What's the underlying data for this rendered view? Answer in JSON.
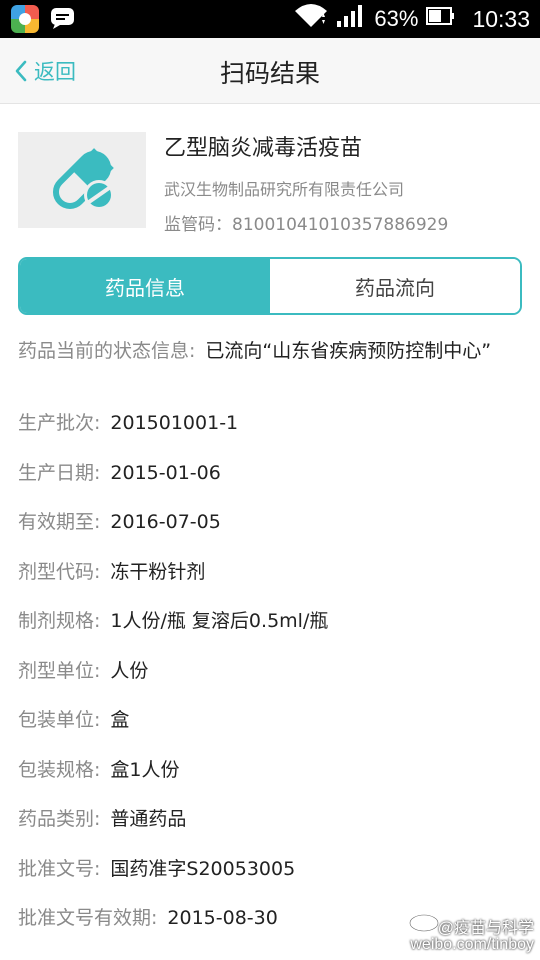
{
  "status_bar": {
    "battery_percent": "63%",
    "time": "10:33",
    "icons": [
      "app-launcher-icon",
      "message-icon",
      "wifi-icon",
      "signal-icon",
      "battery-icon"
    ]
  },
  "header": {
    "back_label": "返回",
    "title": "扫码结果"
  },
  "product": {
    "icon": "pill-icon",
    "name": "乙型脑炎减毒活疫苗",
    "company": "武汉生物制品研究所有限责任公司",
    "code_label": "监管码：81001041010357886929"
  },
  "tabs": [
    {
      "label": "药品信息",
      "active": true
    },
    {
      "label": "药品流向",
      "active": false
    }
  ],
  "details": [
    {
      "key": "药品当前的状态信息:",
      "value": "已流向“山东省疾病预防控制中心”"
    },
    {
      "key": "生产批次:",
      "value": "201501001-1"
    },
    {
      "key": "生产日期:",
      "value": "2015-01-06"
    },
    {
      "key": "有效期至:",
      "value": "2016-07-05"
    },
    {
      "key": "剂型代码:",
      "value": "冻干粉针剂"
    },
    {
      "key": "制剂规格:",
      "value": "1人份/瓶 复溶后0.5ml/瓶"
    },
    {
      "key": "剂型单位:",
      "value": "人份"
    },
    {
      "key": "包装单位:",
      "value": "盒"
    },
    {
      "key": "包装规格:",
      "value": "盒1人份"
    },
    {
      "key": "药品类别:",
      "value": "普通药品"
    },
    {
      "key": "批准文号:",
      "value": "国药准字S20053005"
    },
    {
      "key": "批准文号有效期:",
      "value": "2015-08-30"
    }
  ],
  "watermark": {
    "line1": "@疫苗与科学",
    "line2": "weibo.com/tinboy"
  },
  "colors": {
    "accent": "#3bbbc0",
    "label_gray": "#8a8a8a",
    "status_bar": "#000000"
  }
}
